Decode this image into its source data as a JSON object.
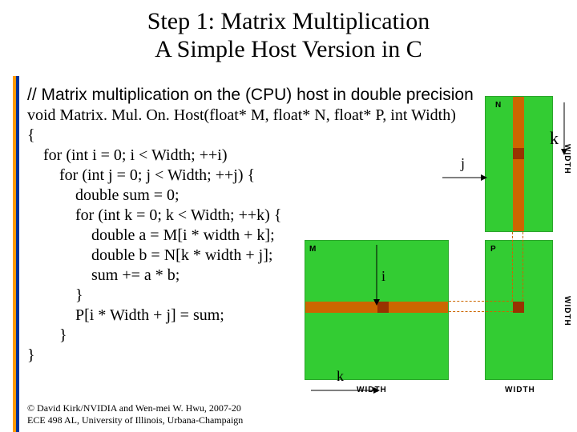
{
  "title_line1": "Step 1: Matrix Multiplication",
  "title_line2": "A Simple Host Version in C",
  "desc": "// Matrix multiplication on the (CPU) host in double precision",
  "sig": "void Matrix. Mul. On. Host(float* M, float* N, float* P, int Width)",
  "code": "{\n    for (int i = 0; i < Width; ++i)\n        for (int j = 0; j < Width; ++j) {\n            double sum = 0;\n            for (int k = 0; k < Width; ++k) {\n                double a = M[i * width + k];\n                double b = N[k * width + j];\n                sum += a * b;\n            }\n            P[i * Width + j] = sum;\n        }\n}",
  "footer1": "© David Kirk/NVIDIA and Wen-mei W. Hwu, 2007-20",
  "footer2": "ECE 498 AL, University of Illinois, Urbana-Champaign",
  "labels": {
    "N": "N",
    "M": "M",
    "P": "P",
    "i": "i",
    "j": "j",
    "k_top": "k",
    "k_bot": "k",
    "width": "WIDTH"
  }
}
